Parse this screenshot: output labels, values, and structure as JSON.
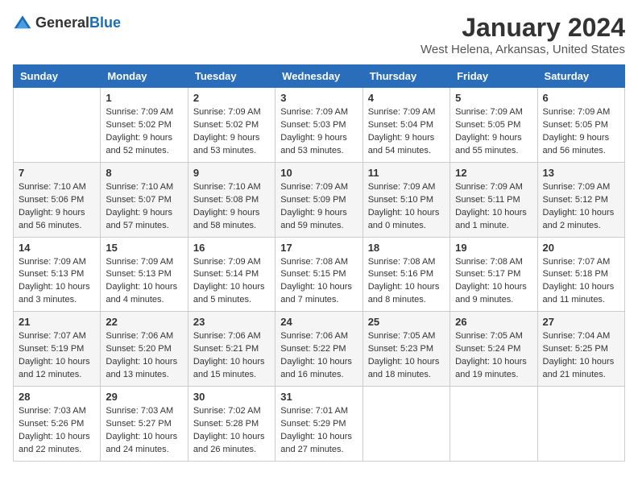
{
  "logo": {
    "text_general": "General",
    "text_blue": "Blue"
  },
  "title": "January 2024",
  "location": "West Helena, Arkansas, United States",
  "days_of_week": [
    "Sunday",
    "Monday",
    "Tuesday",
    "Wednesday",
    "Thursday",
    "Friday",
    "Saturday"
  ],
  "weeks": [
    [
      {
        "day": "",
        "info": ""
      },
      {
        "day": "1",
        "info": "Sunrise: 7:09 AM\nSunset: 5:02 PM\nDaylight: 9 hours\nand 52 minutes."
      },
      {
        "day": "2",
        "info": "Sunrise: 7:09 AM\nSunset: 5:02 PM\nDaylight: 9 hours\nand 53 minutes."
      },
      {
        "day": "3",
        "info": "Sunrise: 7:09 AM\nSunset: 5:03 PM\nDaylight: 9 hours\nand 53 minutes."
      },
      {
        "day": "4",
        "info": "Sunrise: 7:09 AM\nSunset: 5:04 PM\nDaylight: 9 hours\nand 54 minutes."
      },
      {
        "day": "5",
        "info": "Sunrise: 7:09 AM\nSunset: 5:05 PM\nDaylight: 9 hours\nand 55 minutes."
      },
      {
        "day": "6",
        "info": "Sunrise: 7:09 AM\nSunset: 5:05 PM\nDaylight: 9 hours\nand 56 minutes."
      }
    ],
    [
      {
        "day": "7",
        "info": "Sunrise: 7:10 AM\nSunset: 5:06 PM\nDaylight: 9 hours\nand 56 minutes."
      },
      {
        "day": "8",
        "info": "Sunrise: 7:10 AM\nSunset: 5:07 PM\nDaylight: 9 hours\nand 57 minutes."
      },
      {
        "day": "9",
        "info": "Sunrise: 7:10 AM\nSunset: 5:08 PM\nDaylight: 9 hours\nand 58 minutes."
      },
      {
        "day": "10",
        "info": "Sunrise: 7:09 AM\nSunset: 5:09 PM\nDaylight: 9 hours\nand 59 minutes."
      },
      {
        "day": "11",
        "info": "Sunrise: 7:09 AM\nSunset: 5:10 PM\nDaylight: 10 hours\nand 0 minutes."
      },
      {
        "day": "12",
        "info": "Sunrise: 7:09 AM\nSunset: 5:11 PM\nDaylight: 10 hours\nand 1 minute."
      },
      {
        "day": "13",
        "info": "Sunrise: 7:09 AM\nSunset: 5:12 PM\nDaylight: 10 hours\nand 2 minutes."
      }
    ],
    [
      {
        "day": "14",
        "info": "Sunrise: 7:09 AM\nSunset: 5:13 PM\nDaylight: 10 hours\nand 3 minutes."
      },
      {
        "day": "15",
        "info": "Sunrise: 7:09 AM\nSunset: 5:13 PM\nDaylight: 10 hours\nand 4 minutes."
      },
      {
        "day": "16",
        "info": "Sunrise: 7:09 AM\nSunset: 5:14 PM\nDaylight: 10 hours\nand 5 minutes."
      },
      {
        "day": "17",
        "info": "Sunrise: 7:08 AM\nSunset: 5:15 PM\nDaylight: 10 hours\nand 7 minutes."
      },
      {
        "day": "18",
        "info": "Sunrise: 7:08 AM\nSunset: 5:16 PM\nDaylight: 10 hours\nand 8 minutes."
      },
      {
        "day": "19",
        "info": "Sunrise: 7:08 AM\nSunset: 5:17 PM\nDaylight: 10 hours\nand 9 minutes."
      },
      {
        "day": "20",
        "info": "Sunrise: 7:07 AM\nSunset: 5:18 PM\nDaylight: 10 hours\nand 11 minutes."
      }
    ],
    [
      {
        "day": "21",
        "info": "Sunrise: 7:07 AM\nSunset: 5:19 PM\nDaylight: 10 hours\nand 12 minutes."
      },
      {
        "day": "22",
        "info": "Sunrise: 7:06 AM\nSunset: 5:20 PM\nDaylight: 10 hours\nand 13 minutes."
      },
      {
        "day": "23",
        "info": "Sunrise: 7:06 AM\nSunset: 5:21 PM\nDaylight: 10 hours\nand 15 minutes."
      },
      {
        "day": "24",
        "info": "Sunrise: 7:06 AM\nSunset: 5:22 PM\nDaylight: 10 hours\nand 16 minutes."
      },
      {
        "day": "25",
        "info": "Sunrise: 7:05 AM\nSunset: 5:23 PM\nDaylight: 10 hours\nand 18 minutes."
      },
      {
        "day": "26",
        "info": "Sunrise: 7:05 AM\nSunset: 5:24 PM\nDaylight: 10 hours\nand 19 minutes."
      },
      {
        "day": "27",
        "info": "Sunrise: 7:04 AM\nSunset: 5:25 PM\nDaylight: 10 hours\nand 21 minutes."
      }
    ],
    [
      {
        "day": "28",
        "info": "Sunrise: 7:03 AM\nSunset: 5:26 PM\nDaylight: 10 hours\nand 22 minutes."
      },
      {
        "day": "29",
        "info": "Sunrise: 7:03 AM\nSunset: 5:27 PM\nDaylight: 10 hours\nand 24 minutes."
      },
      {
        "day": "30",
        "info": "Sunrise: 7:02 AM\nSunset: 5:28 PM\nDaylight: 10 hours\nand 26 minutes."
      },
      {
        "day": "31",
        "info": "Sunrise: 7:01 AM\nSunset: 5:29 PM\nDaylight: 10 hours\nand 27 minutes."
      },
      {
        "day": "",
        "info": ""
      },
      {
        "day": "",
        "info": ""
      },
      {
        "day": "",
        "info": ""
      }
    ]
  ]
}
